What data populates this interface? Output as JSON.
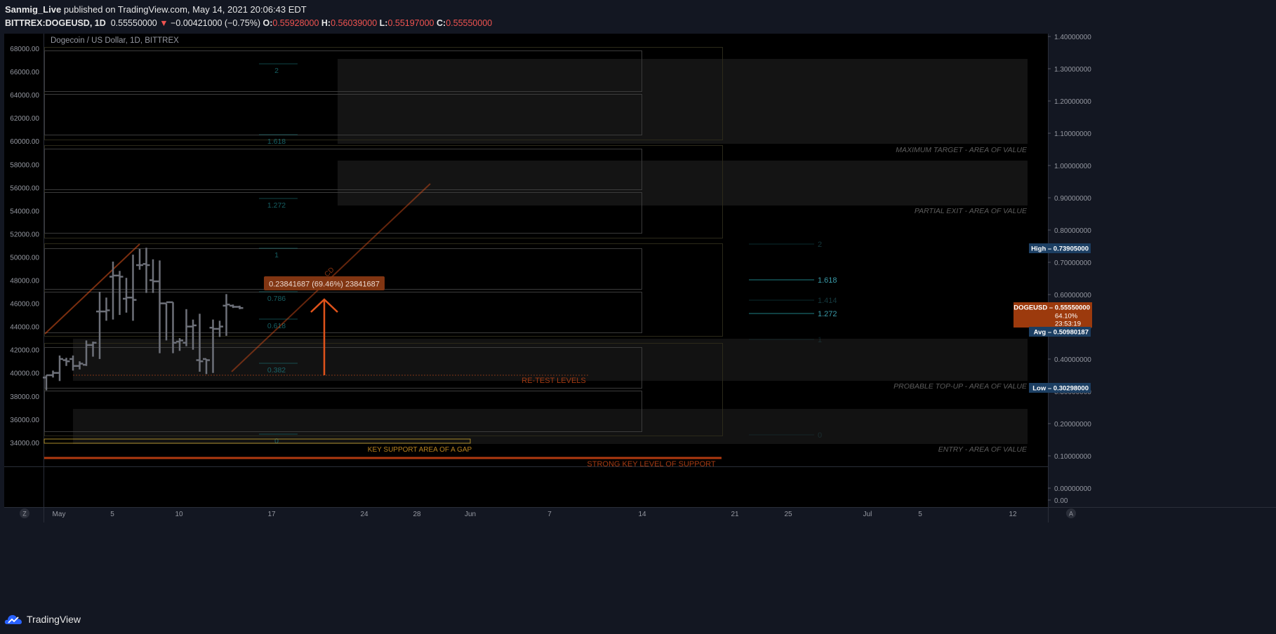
{
  "header": {
    "author": "Sanmig_Live",
    "published_text": "published on TradingView.com, May 14, 2021 20:06:43 EDT",
    "symbol": "BITTREX:DOGEUSD, 1D",
    "last": "0.55550000",
    "change": "−0.00421000 (−0.75%)",
    "o_label": "O:",
    "o": "0.55928000",
    "h_label": "H:",
    "h": "0.56039000",
    "l_label": "L:",
    "l": "0.55197000",
    "c_label": "C:",
    "c": "0.55550000"
  },
  "footer": {
    "brand": "TradingView",
    "z_label": "Z",
    "a_label": "A"
  },
  "colors": {
    "background": "#131722",
    "pane": "#000000",
    "bar": "#6d7079",
    "orange": "#e0531b",
    "teal": "#1e7f84",
    "down": "#ef5350"
  },
  "chart_data": {
    "type": "ohlc",
    "title": "Dogecoin / US Dollar, 1D, BITTREX",
    "left_axis": {
      "ylim": [
        33000,
        69000
      ],
      "ticks": [
        "68000.00",
        "66000.00",
        "64000.00",
        "62000.00",
        "60000.00",
        "58000.00",
        "56000.00",
        "54000.00",
        "52000.00",
        "50000.00",
        "48000.00",
        "46000.00",
        "44000.00",
        "42000.00",
        "40000.00",
        "38000.00",
        "36000.00",
        "34000.00"
      ]
    },
    "right_axis": {
      "ticks": [
        "1.40000000",
        "1.30000000",
        "1.20000000",
        "1.10000000",
        "1.00000000",
        "0.90000000",
        "0.80000000",
        "0.70000000",
        "0.60000000",
        "0.50000000",
        "0.40000000",
        "0.30000000",
        "0.20000000",
        "0.10000000",
        "0.00000000",
        "0.00"
      ]
    },
    "x_ticks": [
      "May",
      "5",
      "10",
      "17",
      "24",
      "28",
      "Jun",
      "7",
      "14",
      "21",
      "25",
      "Jul",
      "5",
      "12"
    ],
    "bars": [
      {
        "o": 39600,
        "h": 39800,
        "l": 38500,
        "c": 39800
      },
      {
        "o": 39800,
        "h": 40200,
        "l": 39600,
        "c": 40000
      },
      {
        "o": 40000,
        "h": 41500,
        "l": 39300,
        "c": 41200
      },
      {
        "o": 41100,
        "h": 41300,
        "l": 40600,
        "c": 41000
      },
      {
        "o": 41200,
        "h": 41500,
        "l": 40200,
        "c": 40600
      },
      {
        "o": 40600,
        "h": 41000,
        "l": 40300,
        "c": 40800
      },
      {
        "o": 40700,
        "h": 42800,
        "l": 40600,
        "c": 42400
      },
      {
        "o": 42400,
        "h": 42700,
        "l": 41400,
        "c": 42600
      },
      {
        "o": 45300,
        "h": 47000,
        "l": 41200,
        "c": 45300
      },
      {
        "o": 45300,
        "h": 46500,
        "l": 44500,
        "c": 45400
      },
      {
        "o": 48300,
        "h": 49600,
        "l": 44600,
        "c": 48400
      },
      {
        "o": 48400,
        "h": 48800,
        "l": 45000,
        "c": 48300
      },
      {
        "o": 46400,
        "h": 48200,
        "l": 45200,
        "c": 46500
      },
      {
        "o": 46500,
        "h": 50200,
        "l": 44500,
        "c": 46300
      },
      {
        "o": 49300,
        "h": 50700,
        "l": 48900,
        "c": 49300
      },
      {
        "o": 49400,
        "h": 50800,
        "l": 46900,
        "c": 49300
      },
      {
        "o": 48000,
        "h": 49800,
        "l": 46900,
        "c": 47900
      },
      {
        "o": 47900,
        "h": 49700,
        "l": 41700,
        "c": 46000
      },
      {
        "o": 46000,
        "h": 46000,
        "l": 42800,
        "c": 46100
      },
      {
        "o": 46100,
        "h": 46100,
        "l": 41700,
        "c": 42600
      },
      {
        "o": 42700,
        "h": 43000,
        "l": 41900,
        "c": 42800
      },
      {
        "o": 42600,
        "h": 45500,
        "l": 42300,
        "c": 44000
      },
      {
        "o": 44000,
        "h": 44600,
        "l": 42000,
        "c": 44100
      },
      {
        "o": 41100,
        "h": 45100,
        "l": 40100,
        "c": 41000
      },
      {
        "o": 41200,
        "h": 41200,
        "l": 39900,
        "c": 41100
      },
      {
        "o": 43900,
        "h": 44600,
        "l": 40000,
        "c": 43800
      },
      {
        "o": 43800,
        "h": 44500,
        "l": 43100,
        "c": 44000
      },
      {
        "o": 45800,
        "h": 46800,
        "l": 43200,
        "c": 45900
      },
      {
        "o": 45800,
        "h": 45900,
        "l": 45600,
        "c": 45700
      },
      {
        "o": 45700,
        "h": 45800,
        "l": 45500,
        "c": 45600
      }
    ],
    "fib_levels": [
      "2",
      "1.618",
      "1.272",
      "1",
      "0.786",
      "0.618",
      "0.382",
      "0"
    ],
    "right_fib_levels": [
      "2",
      "1.618",
      "1.414",
      "1.272",
      "1",
      "0"
    ],
    "zone_labels": [
      "MAXIMUM TARGET - AREA OF VALUE",
      "PARTIAL EXIT - AREA OF VALUE",
      "PROBABLE TOP-UP - AREA OF VALUE",
      "ENTRY - AREA OF VALUE"
    ],
    "annotations": [
      "RE-TEST LEVELS",
      "KEY SUPPORT AREA OF A GAP",
      "STRONG KEY LEVEL OF SUPPORT",
      "CD"
    ],
    "measure_label": "0.23841687 (69.46%) 23841687",
    "price_labels": [
      {
        "name": "High",
        "value": "0.73905000"
      },
      {
        "name": "DOGEUSD",
        "value": "0.55550000"
      },
      {
        "name": "",
        "value": "64.10%"
      },
      {
        "name": "",
        "value": "23:53:19"
      },
      {
        "name": "Avg",
        "value": "0.50980187"
      },
      {
        "name": "Low",
        "value": "0.30298000"
      }
    ]
  }
}
